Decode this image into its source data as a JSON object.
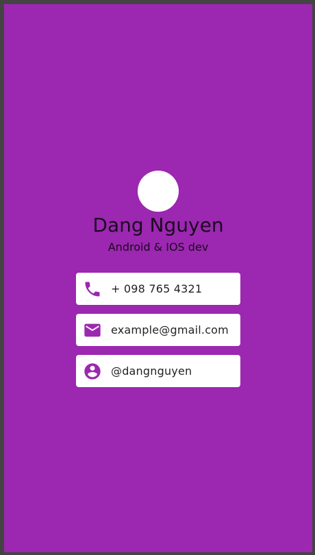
{
  "profile": {
    "name": "Dang Nguyen",
    "title": "Android & IOS dev"
  },
  "contacts": [
    {
      "icon": "phone-icon",
      "text": "+ 098 765 4321"
    },
    {
      "icon": "mail-icon",
      "text": "example@gmail.com"
    },
    {
      "icon": "account-circle-icon",
      "text": "@dangnguyen"
    }
  ],
  "colors": {
    "background": "#9c27b0",
    "card": "#ffffff",
    "icon": "#9c27b0",
    "heading_text": "#1a0a1f"
  }
}
